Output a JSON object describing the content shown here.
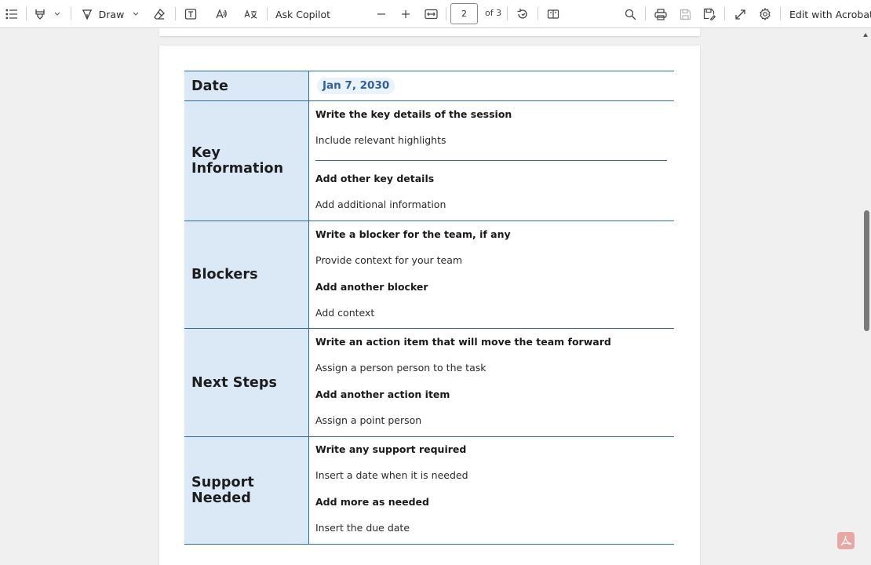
{
  "toolbar": {
    "draw_label": "Draw",
    "ask_copilot_label": "Ask Copilot",
    "page_number": "2",
    "page_total": "of 3",
    "edit_label": "Edit with Acrobat",
    "icons": [
      "contents-icon",
      "highlight-icon",
      "chevron-down-icon",
      "draw-icon",
      "eraser-icon",
      "text-box-icon",
      "read-aloud-icon",
      "translate-icon",
      "zoom-out-icon",
      "zoom-in-icon",
      "fit-page-icon",
      "rotate-icon",
      "page-view-icon",
      "search-icon",
      "print-icon",
      "save-icon",
      "save-as-icon",
      "fullscreen-icon",
      "settings-icon"
    ]
  },
  "document": {
    "rows": [
      {
        "heading": "Date",
        "date": "Jan 7, 2030"
      },
      {
        "heading": "Key Information",
        "lines": [
          "Write the key details of the session",
          "Include relevant highlights",
          "Add other key details",
          "Add additional information"
        ]
      },
      {
        "heading": "Blockers",
        "lines": [
          "Write a blocker for the team, if any",
          "Provide context for your team",
          "Add another blocker",
          "Add context"
        ]
      },
      {
        "heading": "Next Steps",
        "lines": [
          "Write an action item that will move the team forward",
          "Assign a person person to the task",
          "Add another action item",
          "Assign a point person"
        ]
      },
      {
        "heading": "Support Needed",
        "lines": [
          "Write any support required",
          "Insert a date when it is needed",
          "Add more as needed",
          "Insert the due date"
        ]
      }
    ]
  },
  "colors": {
    "accent": "#2e6e9e",
    "label_fill": "#dbe9f7",
    "date_text": "#2f5fa8",
    "acrobat_badge": "#e8a7a3"
  }
}
